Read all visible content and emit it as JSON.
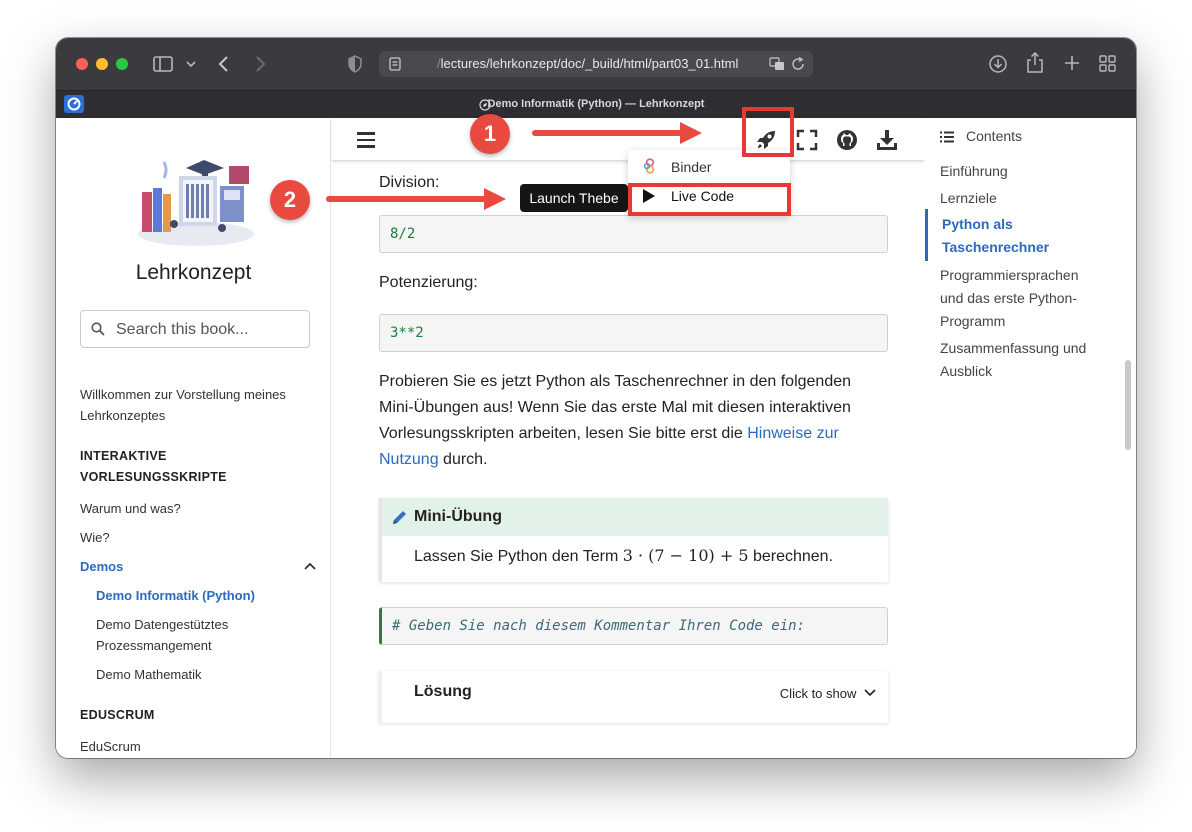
{
  "browser": {
    "url_dim": "/",
    "url": "lectures/lehrkonzept/doc/_build/html/part03_01.html",
    "tab_title": "Demo Informatik (Python) — Lehrkonzept"
  },
  "sidebar": {
    "book_title": "Lehrkonzept",
    "search_placeholder": "Search this book...",
    "welcome_line1": "Willkommen zur Vorstellung meines",
    "welcome_line2": "Lehrkonzeptes",
    "caption1_line1": "INTERAKTIVE",
    "caption1_line2": "VORLESUNGSSKRIPTE",
    "item_warum": "Warum und was?",
    "item_wie": "Wie?",
    "item_demos": "Demos",
    "sub_informatik": "Demo Informatik (Python)",
    "sub_daten_line1": "Demo Datengestütztes",
    "sub_daten_line2": "Prozessmangement",
    "sub_mathematik": "Demo Mathematik",
    "caption2": "EDUSCRUM",
    "item_eduscrum": "EduScrum"
  },
  "content": {
    "division_label": "Division:",
    "division_code": "8/2",
    "potenz_label": "Potenzierung:",
    "potenz_code": "3**2",
    "para_line1": "Probieren Sie es jetzt Python als Taschenrechner in den folgenden",
    "para_line2": "Mini-Übungen aus! Wenn Sie das erste Mal mit diesen interaktiven",
    "para_line3_pre": "Vorlesungsskripten arbeiten, lesen Sie bitte erst die ",
    "para_link_part1": "Hinweise zur",
    "para_link_part2": "Nutzung",
    "para_line4_post": " durch.",
    "exercise_title": "Mini-Übung",
    "exercise_pre": "Lassen Sie Python den Term ",
    "exercise_math": "3 · (7 − 10) + 5",
    "exercise_post": " berechnen.",
    "code_comment": "# Geben Sie nach diesem Kommentar Ihren Code ein:",
    "solution_title": "Lösung",
    "solution_click": "Click to show"
  },
  "launch_menu": {
    "binder": "Binder",
    "live_code": "Live Code",
    "tooltip": "Launch Thebe"
  },
  "toc": {
    "header": "Contents",
    "items": [
      "Einführung",
      "Lernziele",
      "Python als",
      "Taschenrechner",
      "Programmiersprachen",
      "und das erste Python-",
      "Programm",
      "Zusammenfassung und",
      "Ausblick"
    ]
  },
  "annotations": {
    "badge1": "1",
    "badge2": "2"
  },
  "colors": {
    "accent": "#2a6bbf",
    "highlight": "#e53935",
    "admonition_bg": "#e3f2e8"
  }
}
